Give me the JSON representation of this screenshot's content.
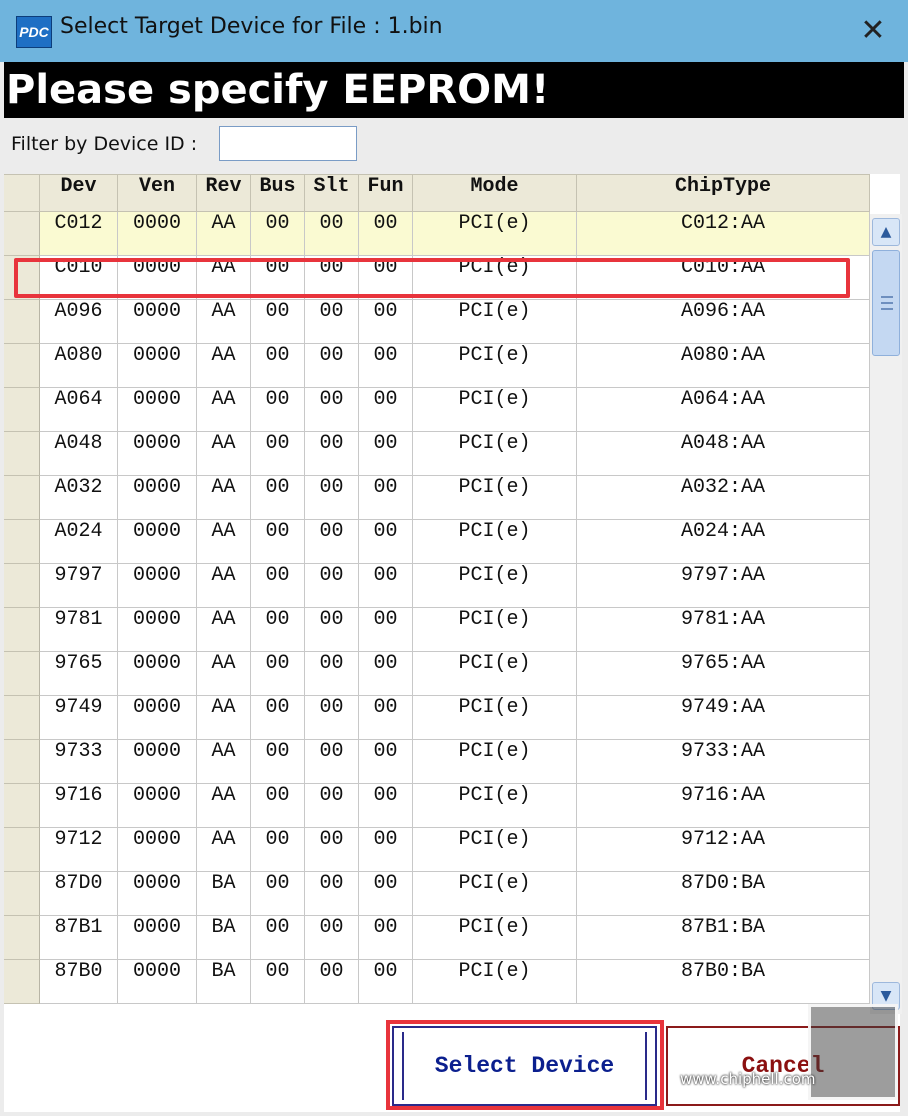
{
  "window": {
    "title": "Select Target Device for File : 1.bin",
    "app_icon_text": "PDC",
    "close_glyph": "✕"
  },
  "banner": {
    "text": "Please specify EEPROM!"
  },
  "filter": {
    "label": "Filter by Device ID :",
    "value": ""
  },
  "table": {
    "columns": [
      "Dev",
      "Ven",
      "Rev",
      "Bus",
      "Slt",
      "Fun",
      "Mode",
      "ChipType"
    ],
    "selected_row": 0,
    "highlighted_row": 1,
    "rows": [
      [
        "C012",
        "0000",
        "AA",
        "00",
        "00",
        "00",
        "PCI(e)",
        "C012:AA"
      ],
      [
        "C010",
        "0000",
        "AA",
        "00",
        "00",
        "00",
        "PCI(e)",
        "C010:AA"
      ],
      [
        "A096",
        "0000",
        "AA",
        "00",
        "00",
        "00",
        "PCI(e)",
        "A096:AA"
      ],
      [
        "A080",
        "0000",
        "AA",
        "00",
        "00",
        "00",
        "PCI(e)",
        "A080:AA"
      ],
      [
        "A064",
        "0000",
        "AA",
        "00",
        "00",
        "00",
        "PCI(e)",
        "A064:AA"
      ],
      [
        "A048",
        "0000",
        "AA",
        "00",
        "00",
        "00",
        "PCI(e)",
        "A048:AA"
      ],
      [
        "A032",
        "0000",
        "AA",
        "00",
        "00",
        "00",
        "PCI(e)",
        "A032:AA"
      ],
      [
        "A024",
        "0000",
        "AA",
        "00",
        "00",
        "00",
        "PCI(e)",
        "A024:AA"
      ],
      [
        "9797",
        "0000",
        "AA",
        "00",
        "00",
        "00",
        "PCI(e)",
        "9797:AA"
      ],
      [
        "9781",
        "0000",
        "AA",
        "00",
        "00",
        "00",
        "PCI(e)",
        "9781:AA"
      ],
      [
        "9765",
        "0000",
        "AA",
        "00",
        "00",
        "00",
        "PCI(e)",
        "9765:AA"
      ],
      [
        "9749",
        "0000",
        "AA",
        "00",
        "00",
        "00",
        "PCI(e)",
        "9749:AA"
      ],
      [
        "9733",
        "0000",
        "AA",
        "00",
        "00",
        "00",
        "PCI(e)",
        "9733:AA"
      ],
      [
        "9716",
        "0000",
        "AA",
        "00",
        "00",
        "00",
        "PCI(e)",
        "9716:AA"
      ],
      [
        "9712",
        "0000",
        "AA",
        "00",
        "00",
        "00",
        "PCI(e)",
        "9712:AA"
      ],
      [
        "87D0",
        "0000",
        "BA",
        "00",
        "00",
        "00",
        "PCI(e)",
        "87D0:BA"
      ],
      [
        "87B1",
        "0000",
        "BA",
        "00",
        "00",
        "00",
        "PCI(e)",
        "87B1:BA"
      ],
      [
        "87B0",
        "0000",
        "BA",
        "00",
        "00",
        "00",
        "PCI(e)",
        "87B0:BA"
      ]
    ]
  },
  "scrollbar": {
    "up_glyph": "▲",
    "down_glyph": "▼"
  },
  "buttons": {
    "select": "Select Device",
    "cancel": "Cancel"
  },
  "watermark": {
    "text": "www.chiphell.com"
  },
  "colors": {
    "titlebar": "#6fb4dd",
    "banner": "#000000",
    "selected_row": "#fafad2",
    "highlight": "#e8343c",
    "select_text": "#0b1f8e",
    "cancel_text": "#8b1010"
  }
}
